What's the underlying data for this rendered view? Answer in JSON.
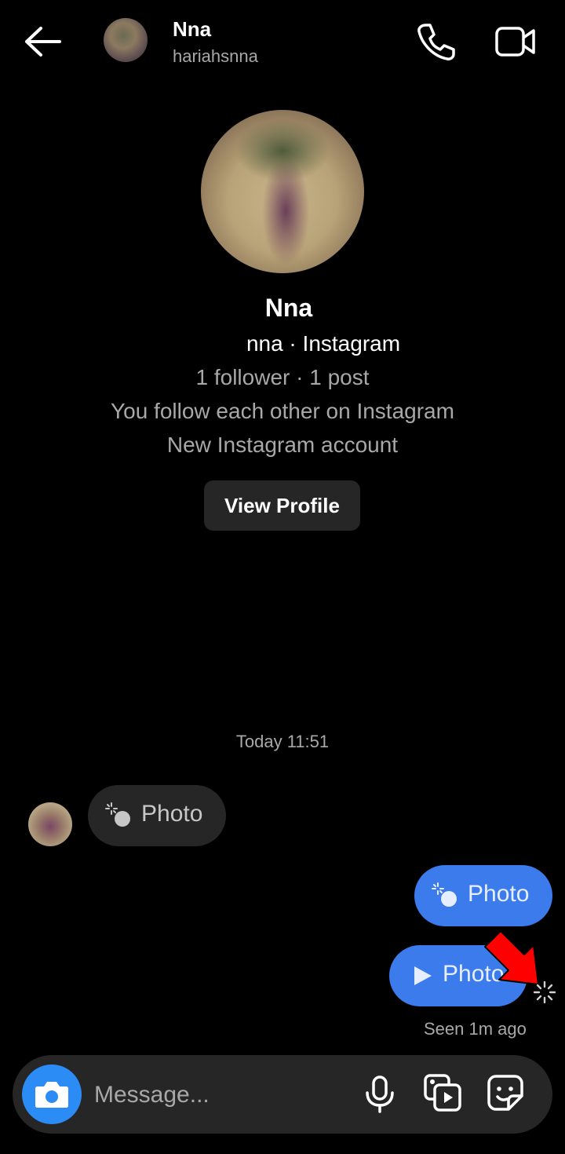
{
  "header": {
    "name": "Nna",
    "username": "hariahsnna"
  },
  "profile": {
    "name": "Nna",
    "subtitle": "nna · Instagram",
    "stats": "1 follower · 1 post",
    "mutual": "You follow each other on Instagram",
    "note": "New Instagram account",
    "view_profile_label": "View Profile"
  },
  "timestamp": "Today 11:51",
  "messages": [
    {
      "direction": "incoming",
      "label": "Photo",
      "icon": "photo-sparkle-icon"
    },
    {
      "direction": "outgoing",
      "label": "Photo",
      "icon": "photo-sparkle-icon"
    },
    {
      "direction": "outgoing",
      "label": "Photo",
      "icon": "play-icon"
    }
  ],
  "seen_status": "Seen 1m ago",
  "composer": {
    "placeholder": "Message..."
  },
  "colors": {
    "background": "#000000",
    "outgoing_bubble": "#3b7bec",
    "incoming_bubble": "#262626",
    "camera_button": "#2b8cf5",
    "annotation_arrow": "#ff0000"
  }
}
